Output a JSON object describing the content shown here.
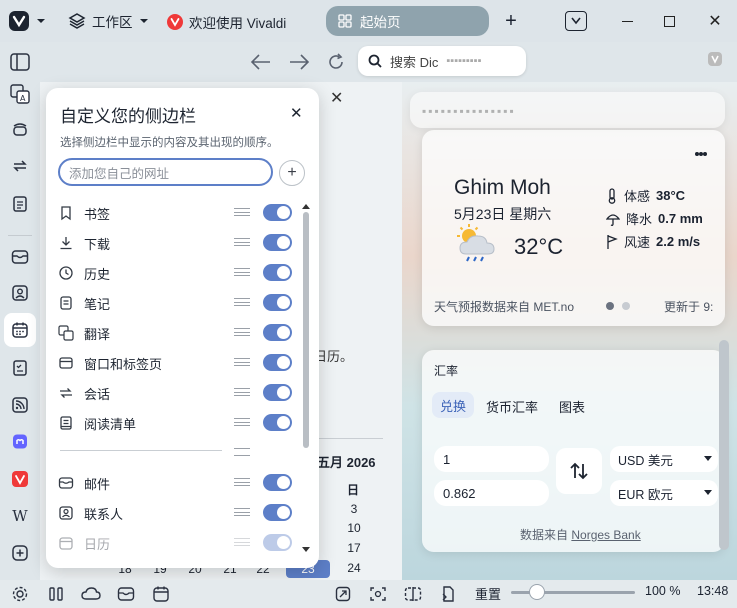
{
  "titlebar": {
    "workspaces_label": "工作区",
    "tab_welcome": "欢迎使用 Vivaldi",
    "tab_active": "起始页"
  },
  "addressbar": {
    "search_placeholder": "搜索 Dic"
  },
  "panel": {
    "title": "自定义您的侧边栏",
    "subtitle": "选择侧边栏中显示的内容及其出现的顺序。",
    "url_placeholder": "添加您自己的网址",
    "items": [
      {
        "label": "书签",
        "icon": "bookmark-icon",
        "enabled": true
      },
      {
        "label": "下载",
        "icon": "download-icon",
        "enabled": true
      },
      {
        "label": "历史",
        "icon": "history-icon",
        "enabled": true
      },
      {
        "label": "笔记",
        "icon": "notes-icon",
        "enabled": true
      },
      {
        "label": "翻译",
        "icon": "translate-icon",
        "enabled": true
      },
      {
        "label": "窗口和标签页",
        "icon": "window-icon",
        "enabled": true
      },
      {
        "label": "会话",
        "icon": "sessions-icon",
        "enabled": true
      },
      {
        "label": "阅读清单",
        "icon": "reading-list-icon",
        "enabled": true
      },
      {
        "label": "邮件",
        "icon": "mail-icon",
        "enabled": true
      },
      {
        "label": "联系人",
        "icon": "contacts-icon",
        "enabled": true
      },
      {
        "label": "日历",
        "icon": "calendar-icon",
        "enabled": true
      }
    ]
  },
  "background": {
    "partial_text": "日历。",
    "calendar_month": "五月 2026",
    "calendar_col_header": "日",
    "calendar_days": [
      "3",
      "10",
      "17",
      "24"
    ],
    "calendar_bottom_row": [
      "18",
      "19",
      "20",
      "21",
      "22",
      "23"
    ]
  },
  "weather": {
    "city": "Ghim Moh",
    "date": "5月23日 星期六",
    "temp": "32°C",
    "feels_label": "体感",
    "feels_value": "38°C",
    "rain_label": "降水",
    "rain_value": "0.7 mm",
    "wind_label": "风速",
    "wind_value": "2.2 m/s",
    "source": "天气预报数据来自 MET.no",
    "updated": "更新于 9:"
  },
  "currency": {
    "title": "汇率",
    "tabs": [
      "兑换",
      "货币汇率",
      "图表"
    ],
    "amount_from": "1",
    "amount_to": "0.862",
    "currency_from": "USD 美元",
    "currency_to": "EUR 欧元",
    "source_prefix": "数据来自",
    "source_link": "Norges Bank"
  },
  "statusbar": {
    "reset_label": "重置",
    "zoom": "100 %",
    "time": "13:48"
  },
  "colors": {
    "accent": "#5d7fc8",
    "active_tab": "#8fa3ad"
  }
}
